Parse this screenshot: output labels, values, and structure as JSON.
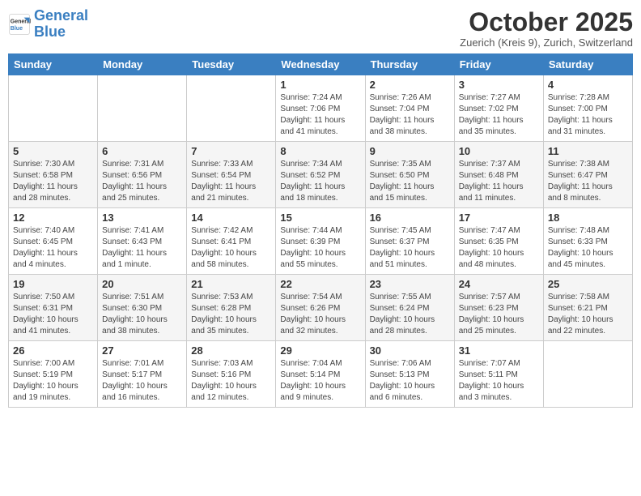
{
  "header": {
    "logo_general": "General",
    "logo_blue": "Blue",
    "title": "October 2025",
    "subtitle": "Zuerich (Kreis 9), Zurich, Switzerland"
  },
  "days_of_week": [
    "Sunday",
    "Monday",
    "Tuesday",
    "Wednesday",
    "Thursday",
    "Friday",
    "Saturday"
  ],
  "weeks": [
    [
      {
        "day": "",
        "info": ""
      },
      {
        "day": "",
        "info": ""
      },
      {
        "day": "",
        "info": ""
      },
      {
        "day": "1",
        "info": "Sunrise: 7:24 AM\nSunset: 7:06 PM\nDaylight: 11 hours\nand 41 minutes."
      },
      {
        "day": "2",
        "info": "Sunrise: 7:26 AM\nSunset: 7:04 PM\nDaylight: 11 hours\nand 38 minutes."
      },
      {
        "day": "3",
        "info": "Sunrise: 7:27 AM\nSunset: 7:02 PM\nDaylight: 11 hours\nand 35 minutes."
      },
      {
        "day": "4",
        "info": "Sunrise: 7:28 AM\nSunset: 7:00 PM\nDaylight: 11 hours\nand 31 minutes."
      }
    ],
    [
      {
        "day": "5",
        "info": "Sunrise: 7:30 AM\nSunset: 6:58 PM\nDaylight: 11 hours\nand 28 minutes."
      },
      {
        "day": "6",
        "info": "Sunrise: 7:31 AM\nSunset: 6:56 PM\nDaylight: 11 hours\nand 25 minutes."
      },
      {
        "day": "7",
        "info": "Sunrise: 7:33 AM\nSunset: 6:54 PM\nDaylight: 11 hours\nand 21 minutes."
      },
      {
        "day": "8",
        "info": "Sunrise: 7:34 AM\nSunset: 6:52 PM\nDaylight: 11 hours\nand 18 minutes."
      },
      {
        "day": "9",
        "info": "Sunrise: 7:35 AM\nSunset: 6:50 PM\nDaylight: 11 hours\nand 15 minutes."
      },
      {
        "day": "10",
        "info": "Sunrise: 7:37 AM\nSunset: 6:48 PM\nDaylight: 11 hours\nand 11 minutes."
      },
      {
        "day": "11",
        "info": "Sunrise: 7:38 AM\nSunset: 6:47 PM\nDaylight: 11 hours\nand 8 minutes."
      }
    ],
    [
      {
        "day": "12",
        "info": "Sunrise: 7:40 AM\nSunset: 6:45 PM\nDaylight: 11 hours\nand 4 minutes."
      },
      {
        "day": "13",
        "info": "Sunrise: 7:41 AM\nSunset: 6:43 PM\nDaylight: 11 hours\nand 1 minute."
      },
      {
        "day": "14",
        "info": "Sunrise: 7:42 AM\nSunset: 6:41 PM\nDaylight: 10 hours\nand 58 minutes."
      },
      {
        "day": "15",
        "info": "Sunrise: 7:44 AM\nSunset: 6:39 PM\nDaylight: 10 hours\nand 55 minutes."
      },
      {
        "day": "16",
        "info": "Sunrise: 7:45 AM\nSunset: 6:37 PM\nDaylight: 10 hours\nand 51 minutes."
      },
      {
        "day": "17",
        "info": "Sunrise: 7:47 AM\nSunset: 6:35 PM\nDaylight: 10 hours\nand 48 minutes."
      },
      {
        "day": "18",
        "info": "Sunrise: 7:48 AM\nSunset: 6:33 PM\nDaylight: 10 hours\nand 45 minutes."
      }
    ],
    [
      {
        "day": "19",
        "info": "Sunrise: 7:50 AM\nSunset: 6:31 PM\nDaylight: 10 hours\nand 41 minutes."
      },
      {
        "day": "20",
        "info": "Sunrise: 7:51 AM\nSunset: 6:30 PM\nDaylight: 10 hours\nand 38 minutes."
      },
      {
        "day": "21",
        "info": "Sunrise: 7:53 AM\nSunset: 6:28 PM\nDaylight: 10 hours\nand 35 minutes."
      },
      {
        "day": "22",
        "info": "Sunrise: 7:54 AM\nSunset: 6:26 PM\nDaylight: 10 hours\nand 32 minutes."
      },
      {
        "day": "23",
        "info": "Sunrise: 7:55 AM\nSunset: 6:24 PM\nDaylight: 10 hours\nand 28 minutes."
      },
      {
        "day": "24",
        "info": "Sunrise: 7:57 AM\nSunset: 6:23 PM\nDaylight: 10 hours\nand 25 minutes."
      },
      {
        "day": "25",
        "info": "Sunrise: 7:58 AM\nSunset: 6:21 PM\nDaylight: 10 hours\nand 22 minutes."
      }
    ],
    [
      {
        "day": "26",
        "info": "Sunrise: 7:00 AM\nSunset: 5:19 PM\nDaylight: 10 hours\nand 19 minutes."
      },
      {
        "day": "27",
        "info": "Sunrise: 7:01 AM\nSunset: 5:17 PM\nDaylight: 10 hours\nand 16 minutes."
      },
      {
        "day": "28",
        "info": "Sunrise: 7:03 AM\nSunset: 5:16 PM\nDaylight: 10 hours\nand 12 minutes."
      },
      {
        "day": "29",
        "info": "Sunrise: 7:04 AM\nSunset: 5:14 PM\nDaylight: 10 hours\nand 9 minutes."
      },
      {
        "day": "30",
        "info": "Sunrise: 7:06 AM\nSunset: 5:13 PM\nDaylight: 10 hours\nand 6 minutes."
      },
      {
        "day": "31",
        "info": "Sunrise: 7:07 AM\nSunset: 5:11 PM\nDaylight: 10 hours\nand 3 minutes."
      },
      {
        "day": "",
        "info": ""
      }
    ]
  ]
}
